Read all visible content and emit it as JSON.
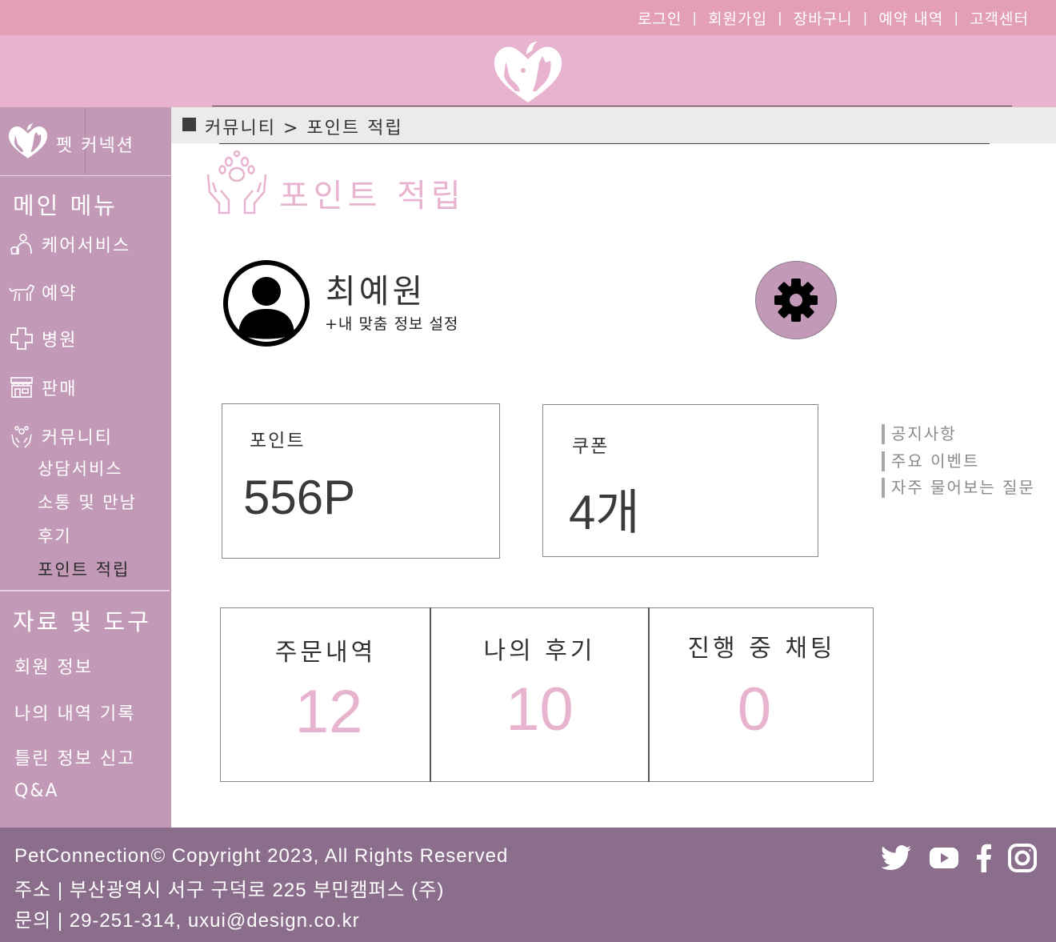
{
  "top_nav": {
    "links": [
      "로그인",
      "회원가입",
      "장바구니",
      "예약 내역",
      "고객센터"
    ],
    "separator": "|"
  },
  "sidebar": {
    "brand_name": "펫 커넥션",
    "main_menu_heading": "메인 메뉴",
    "main_items": [
      {
        "label": "케어서비스",
        "icon": "care-icon"
      },
      {
        "label": "예약",
        "icon": "dog-icon"
      },
      {
        "label": "병원",
        "icon": "medical-cross-icon"
      },
      {
        "label": "판매",
        "icon": "store-icon"
      },
      {
        "label": "커뮤니티",
        "icon": "community-icon"
      }
    ],
    "community_sub": [
      "상담서비스",
      "소통 및 만남",
      "후기",
      "포인트 적립"
    ],
    "active_sub": "포인트 적립",
    "tools_heading": "자료 및 도구",
    "tools_items": [
      "회원 정보",
      "나의 내역 기록",
      "틀린 정보 신고",
      "Q&A"
    ]
  },
  "breadcrumb": "커뮤니티 > 포인트 적립",
  "page_title": "포인트 적립",
  "profile": {
    "name": "최예원",
    "settings_link": "+내 맞춤 정보 설정"
  },
  "stats": {
    "points_label": "포인트",
    "points_value": "556P",
    "coupon_label": "쿠폰",
    "coupon_value": "4개"
  },
  "notice_links": [
    "공지사항",
    "주요 이벤트",
    "자주 물어보는 질문"
  ],
  "activity": [
    {
      "label": "주문내역",
      "value": "12"
    },
    {
      "label": "나의 후기",
      "value": "10"
    },
    {
      "label": "진행 중 채팅",
      "value": "0"
    }
  ],
  "footer": {
    "copyright": "PetConnection© Copyright 2023, All Rights Reserved",
    "address": "주소 | 부산광역시 서구 구덕로 225 부민캠퍼스 (주)",
    "contact": "문의 | 29-251-314, uxui@design.co.kr",
    "social": [
      "twitter-icon",
      "youtube-icon",
      "facebook-icon",
      "instagram-icon"
    ]
  },
  "colors": {
    "top_bar": "#e29fb7",
    "header": "#e8b3cf",
    "sidebar": "#c29ab8",
    "footer": "#8b6e8b",
    "accent_pink": "#e8b3cf"
  }
}
